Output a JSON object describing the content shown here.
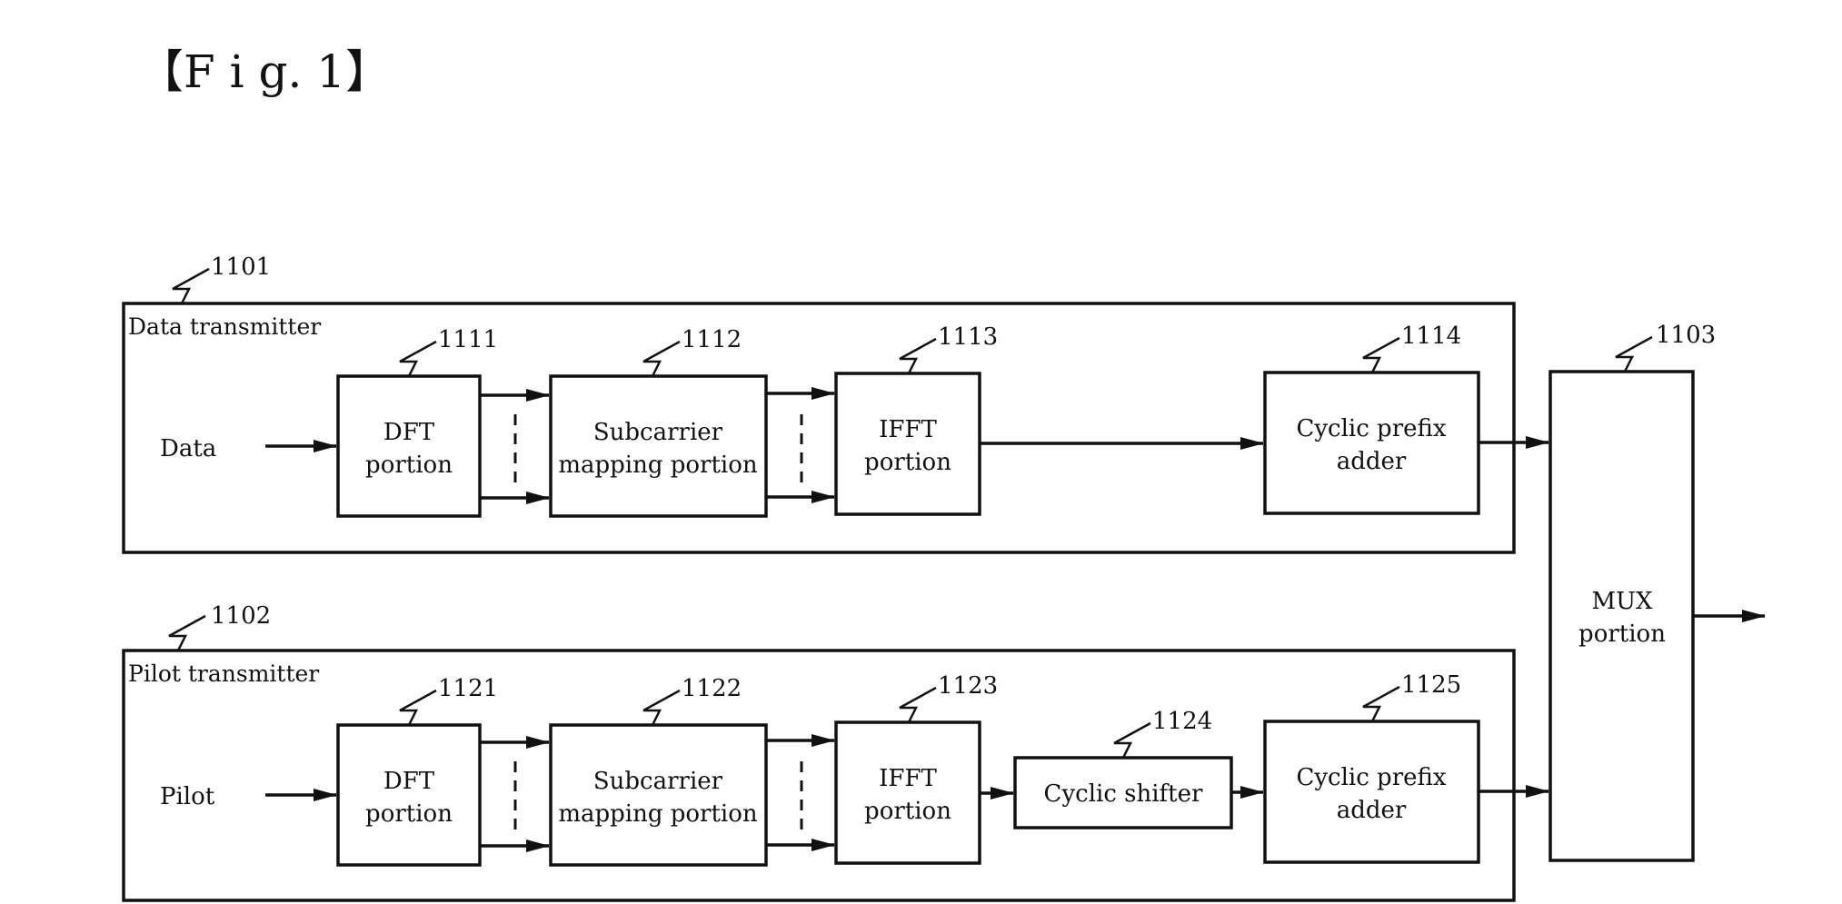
{
  "figure": {
    "label": "【F i g.  1】"
  },
  "data_transmitter": {
    "ref": "1101",
    "title": "Data transmitter",
    "input_label": "Data",
    "blocks": [
      {
        "ref": "1111",
        "lines": [
          "DFT",
          "portion"
        ]
      },
      {
        "ref": "1112",
        "lines": [
          "Subcarrier",
          "mapping portion"
        ]
      },
      {
        "ref": "1113",
        "lines": [
          "IFFT",
          "portion"
        ]
      },
      {
        "ref": "1114",
        "lines": [
          "Cyclic prefix",
          "adder"
        ]
      }
    ]
  },
  "pilot_transmitter": {
    "ref": "1102",
    "title": "Pilot transmitter",
    "input_label": "Pilot",
    "blocks": [
      {
        "ref": "1121",
        "lines": [
          "DFT",
          "portion"
        ]
      },
      {
        "ref": "1122",
        "lines": [
          "Subcarrier",
          "mapping portion"
        ]
      },
      {
        "ref": "1123",
        "lines": [
          "IFFT",
          "portion"
        ]
      },
      {
        "ref": "1124",
        "lines": [
          "Cyclic shifter"
        ]
      },
      {
        "ref": "1125",
        "lines": [
          "Cyclic prefix",
          "adder"
        ]
      }
    ]
  },
  "mux": {
    "ref": "1103",
    "lines": [
      "MUX",
      "portion"
    ]
  }
}
